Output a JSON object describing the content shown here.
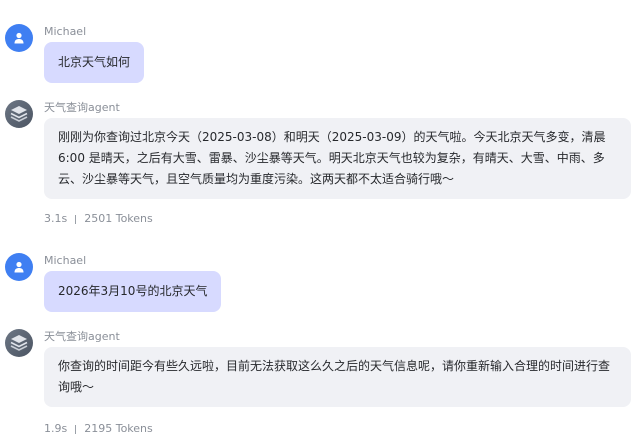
{
  "messages": [
    {
      "sender": "Michael",
      "text": "北京天气如何"
    },
    {
      "sender": "天气查询agent",
      "text": "刚刚为你查询过北京今天（2025-03-08）和明天（2025-03-09）的天气啦。今天北京天气多变，清晨6:00 是晴天，之后有大雪、雷暴、沙尘暴等天气。明天北京天气也较为复杂，有晴天、大雪、中雨、多云、沙尘暴等天气，且空气质量均为重度污染。这两天都不太适合骑行哦～",
      "duration": "3.1s",
      "tokens": "2501 Tokens"
    },
    {
      "sender": "Michael",
      "text": "2026年3月10号的北京天气"
    },
    {
      "sender": "天气查询agent",
      "text": "你查询的时间距今有些久远啦，目前无法获取这么久之后的天气信息呢，请你重新输入合理的时间进行查询哦～",
      "duration": "1.9s",
      "tokens": "2195 Tokens"
    }
  ],
  "colors": {
    "user_avatar": "#3f7ff2",
    "user_bubble": "#d7daff",
    "agent_bubble": "#f0f1f5"
  },
  "icons": {
    "user_avatar": "person-icon",
    "agent_avatar": "layers-icon"
  }
}
